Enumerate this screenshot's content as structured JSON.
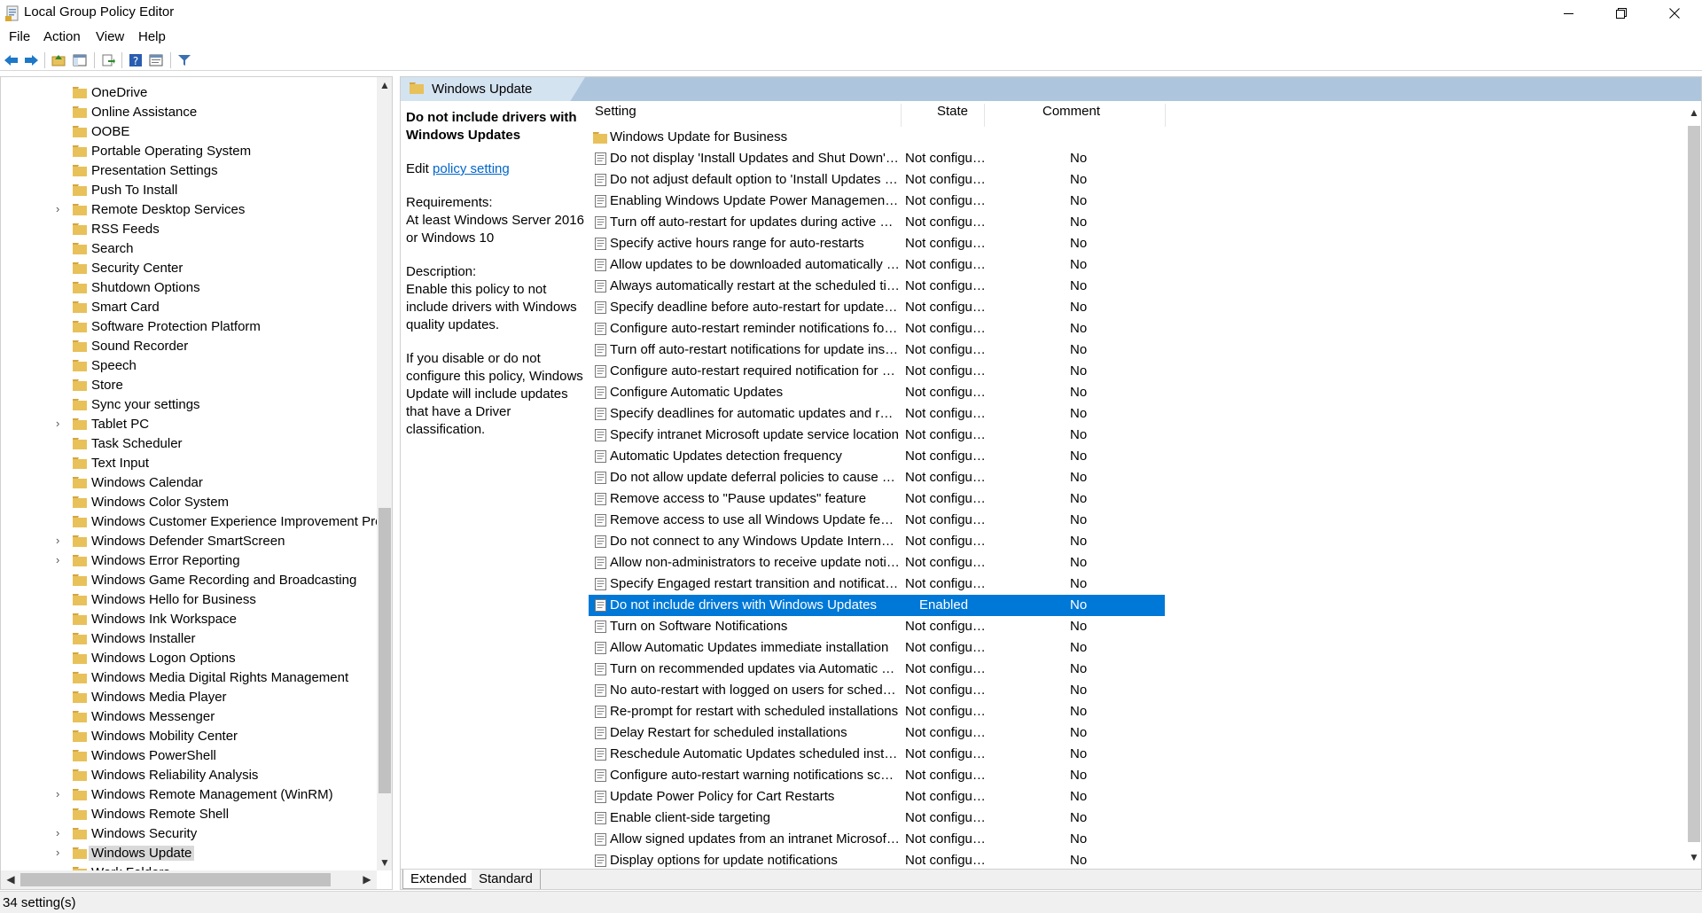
{
  "window": {
    "title": "Local Group Policy Editor",
    "minimize_glyph": "—",
    "maximize_glyph": "❐",
    "close_glyph": "✕"
  },
  "menu": [
    "File",
    "Action",
    "View",
    "Help"
  ],
  "toolbar": {
    "icons": [
      "back-icon",
      "forward-icon",
      "up-folder-icon",
      "show-hide-tree-icon",
      "export-list-icon",
      "help-icon",
      "properties-icon",
      "filter-icon"
    ]
  },
  "tree": {
    "items": [
      {
        "label": "OneDrive",
        "expandable": false
      },
      {
        "label": "Online Assistance",
        "expandable": false
      },
      {
        "label": "OOBE",
        "expandable": false
      },
      {
        "label": "Portable Operating System",
        "expandable": false
      },
      {
        "label": "Presentation Settings",
        "expandable": false
      },
      {
        "label": "Push To Install",
        "expandable": false
      },
      {
        "label": "Remote Desktop Services",
        "expandable": true
      },
      {
        "label": "RSS Feeds",
        "expandable": false
      },
      {
        "label": "Search",
        "expandable": false
      },
      {
        "label": "Security Center",
        "expandable": false
      },
      {
        "label": "Shutdown Options",
        "expandable": false
      },
      {
        "label": "Smart Card",
        "expandable": false
      },
      {
        "label": "Software Protection Platform",
        "expandable": false
      },
      {
        "label": "Sound Recorder",
        "expandable": false
      },
      {
        "label": "Speech",
        "expandable": false
      },
      {
        "label": "Store",
        "expandable": false
      },
      {
        "label": "Sync your settings",
        "expandable": false
      },
      {
        "label": "Tablet PC",
        "expandable": true
      },
      {
        "label": "Task Scheduler",
        "expandable": false
      },
      {
        "label": "Text Input",
        "expandable": false
      },
      {
        "label": "Windows Calendar",
        "expandable": false
      },
      {
        "label": "Windows Color System",
        "expandable": false
      },
      {
        "label": "Windows Customer Experience Improvement Pro",
        "expandable": false
      },
      {
        "label": "Windows Defender SmartScreen",
        "expandable": true
      },
      {
        "label": "Windows Error Reporting",
        "expandable": true
      },
      {
        "label": "Windows Game Recording and Broadcasting",
        "expandable": false
      },
      {
        "label": "Windows Hello for Business",
        "expandable": false
      },
      {
        "label": "Windows Ink Workspace",
        "expandable": false
      },
      {
        "label": "Windows Installer",
        "expandable": false
      },
      {
        "label": "Windows Logon Options",
        "expandable": false
      },
      {
        "label": "Windows Media Digital Rights Management",
        "expandable": false
      },
      {
        "label": "Windows Media Player",
        "expandable": false
      },
      {
        "label": "Windows Messenger",
        "expandable": false
      },
      {
        "label": "Windows Mobility Center",
        "expandable": false
      },
      {
        "label": "Windows PowerShell",
        "expandable": false
      },
      {
        "label": "Windows Reliability Analysis",
        "expandable": false
      },
      {
        "label": "Windows Remote Management (WinRM)",
        "expandable": true
      },
      {
        "label": "Windows Remote Shell",
        "expandable": false
      },
      {
        "label": "Windows Security",
        "expandable": true
      },
      {
        "label": "Windows Update",
        "expandable": true,
        "selected": true
      },
      {
        "label": "Work Folders",
        "expandable": false
      }
    ]
  },
  "right": {
    "header_title": "Windows Update",
    "description": {
      "title": "Do not include drivers with Windows Updates",
      "edit_prefix": "Edit ",
      "edit_link": "policy setting",
      "requirements_label": "Requirements:",
      "requirements_text": "At least Windows Server 2016 or Windows 10",
      "description_label": "Description:",
      "description_text": "Enable this policy to not include drivers with Windows quality updates.",
      "description_text2": "If you disable or do not configure this policy, Windows Update will include updates that have a Driver classification."
    },
    "columns": {
      "setting": "Setting",
      "state": "State",
      "comment": "Comment"
    },
    "folder_row": "Windows Update for Business",
    "rows": [
      {
        "setting": "Do not display 'Install Updates and Shut Down' option in Shut Down Windows dialog box",
        "state": "Not configured",
        "comment": "No"
      },
      {
        "setting": "Do not adjust default option to 'Install Updates and Shut Down' in Shut Down Windows dialog box",
        "state": "Not configured",
        "comment": "No"
      },
      {
        "setting": "Enabling Windows Update Power Management to automatically wake up the system",
        "state": "Not configured",
        "comment": "No"
      },
      {
        "setting": "Turn off auto-restart for updates during active hours",
        "state": "Not configured",
        "comment": "No"
      },
      {
        "setting": "Specify active hours range for auto-restarts",
        "state": "Not configured",
        "comment": "No"
      },
      {
        "setting": "Allow updates to be downloaded automatically over metered connections",
        "state": "Not configured",
        "comment": "No"
      },
      {
        "setting": "Always automatically restart at the scheduled time",
        "state": "Not configured",
        "comment": "No"
      },
      {
        "setting": "Specify deadline before auto-restart for update installation",
        "state": "Not configured",
        "comment": "No"
      },
      {
        "setting": "Configure auto-restart reminder notifications for updates",
        "state": "Not configured",
        "comment": "No"
      },
      {
        "setting": "Turn off auto-restart notifications for update installations",
        "state": "Not configured",
        "comment": "No"
      },
      {
        "setting": "Configure auto-restart required notification for updates",
        "state": "Not configured",
        "comment": "No"
      },
      {
        "setting": "Configure Automatic Updates",
        "state": "Not configured",
        "comment": "No"
      },
      {
        "setting": "Specify deadlines for automatic updates and restarts",
        "state": "Not configured",
        "comment": "No"
      },
      {
        "setting": "Specify intranet Microsoft update service location",
        "state": "Not configured",
        "comment": "No"
      },
      {
        "setting": "Automatic Updates detection frequency",
        "state": "Not configured",
        "comment": "No"
      },
      {
        "setting": "Do not allow update deferral policies to cause scans against Windows Update",
        "state": "Not configured",
        "comment": "No"
      },
      {
        "setting": "Remove access to \"Pause updates\" feature",
        "state": "Not configured",
        "comment": "No"
      },
      {
        "setting": "Remove access to use all Windows Update features",
        "state": "Not configured",
        "comment": "No"
      },
      {
        "setting": "Do not connect to any Windows Update Internet locations",
        "state": "Not configured",
        "comment": "No"
      },
      {
        "setting": "Allow non-administrators to receive update notifications",
        "state": "Not configured",
        "comment": "No"
      },
      {
        "setting": "Specify Engaged restart transition and notification schedule for updates",
        "state": "Not configured",
        "comment": "No"
      },
      {
        "setting": "Do not include drivers with Windows Updates",
        "state": "Enabled",
        "comment": "No",
        "selected": true
      },
      {
        "setting": "Turn on Software Notifications",
        "state": "Not configured",
        "comment": "No"
      },
      {
        "setting": "Allow Automatic Updates immediate installation",
        "state": "Not configured",
        "comment": "No"
      },
      {
        "setting": "Turn on recommended updates via Automatic Updates",
        "state": "Not configured",
        "comment": "No"
      },
      {
        "setting": "No auto-restart with logged on users for scheduled automatic updates installations",
        "state": "Not configured",
        "comment": "No"
      },
      {
        "setting": "Re-prompt for restart with scheduled installations",
        "state": "Not configured",
        "comment": "No"
      },
      {
        "setting": "Delay Restart for scheduled installations",
        "state": "Not configured",
        "comment": "No"
      },
      {
        "setting": "Reschedule Automatic Updates scheduled installations",
        "state": "Not configured",
        "comment": "No"
      },
      {
        "setting": "Configure auto-restart warning notifications schedule for updates",
        "state": "Not configured",
        "comment": "No"
      },
      {
        "setting": "Update Power Policy for Cart Restarts",
        "state": "Not configured",
        "comment": "No"
      },
      {
        "setting": "Enable client-side targeting",
        "state": "Not configured",
        "comment": "No"
      },
      {
        "setting": "Allow signed updates from an intranet Microsoft update service location",
        "state": "Not configured",
        "comment": "No"
      },
      {
        "setting": "Display options for update notifications",
        "state": "Not configured",
        "comment": "No"
      }
    ],
    "tabs": [
      "Extended",
      "Standard"
    ]
  },
  "status": "34 setting(s)",
  "colors": {
    "selection": "#0078d7",
    "header_band": "#aec6dd",
    "link": "#0066cc",
    "folder": "#e8c15a"
  }
}
